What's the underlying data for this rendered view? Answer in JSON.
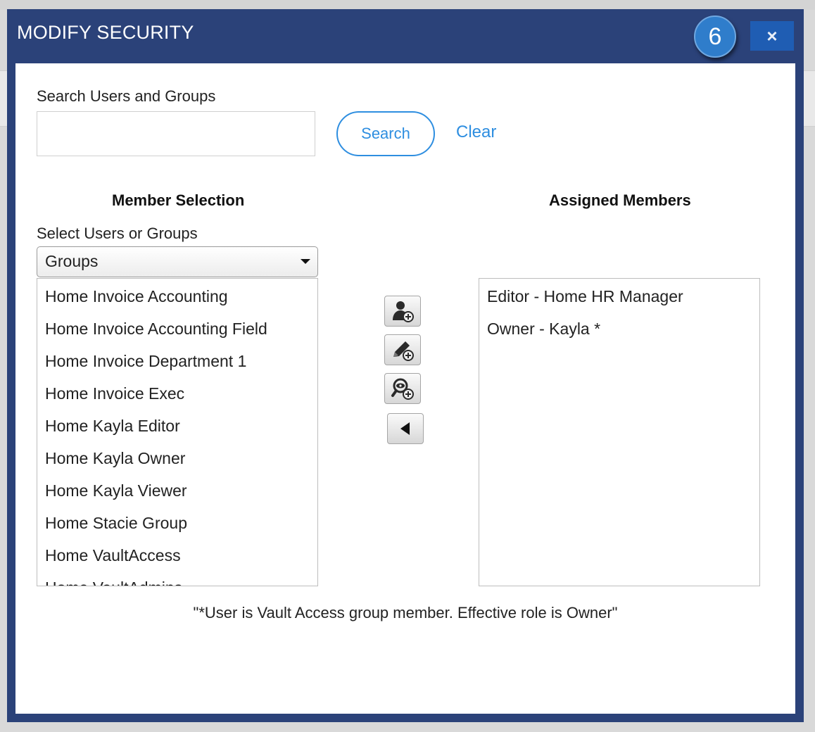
{
  "dialog": {
    "title": "MODIFY SECURITY",
    "step_badge": "6",
    "close_label": "×"
  },
  "search": {
    "label": "Search Users and Groups",
    "value": "",
    "placeholder": "",
    "search_button": "Search",
    "clear_link": "Clear"
  },
  "member_selection": {
    "heading": "Member Selection",
    "select_label": "Select Users or Groups",
    "selected_option": "Groups",
    "items": [
      "Home Invoice Accounting",
      "Home Invoice Accounting Field",
      "Home Invoice Department 1",
      "Home Invoice Exec",
      "Home Kayla Editor",
      "Home Kayla Owner",
      "Home Kayla Viewer",
      "Home Stacie Group",
      "Home VaultAccess",
      "Home VaultAdmins"
    ]
  },
  "tools": {
    "icons": [
      "add-user-icon",
      "add-editor-icon",
      "add-viewer-icon",
      "remove-arrow-icon"
    ]
  },
  "assigned_members": {
    "heading": "Assigned Members",
    "items": [
      "Editor - Home HR Manager",
      "Owner - Kayla *"
    ]
  },
  "footnote": "\"*User is Vault Access group member. Effective role is Owner\""
}
